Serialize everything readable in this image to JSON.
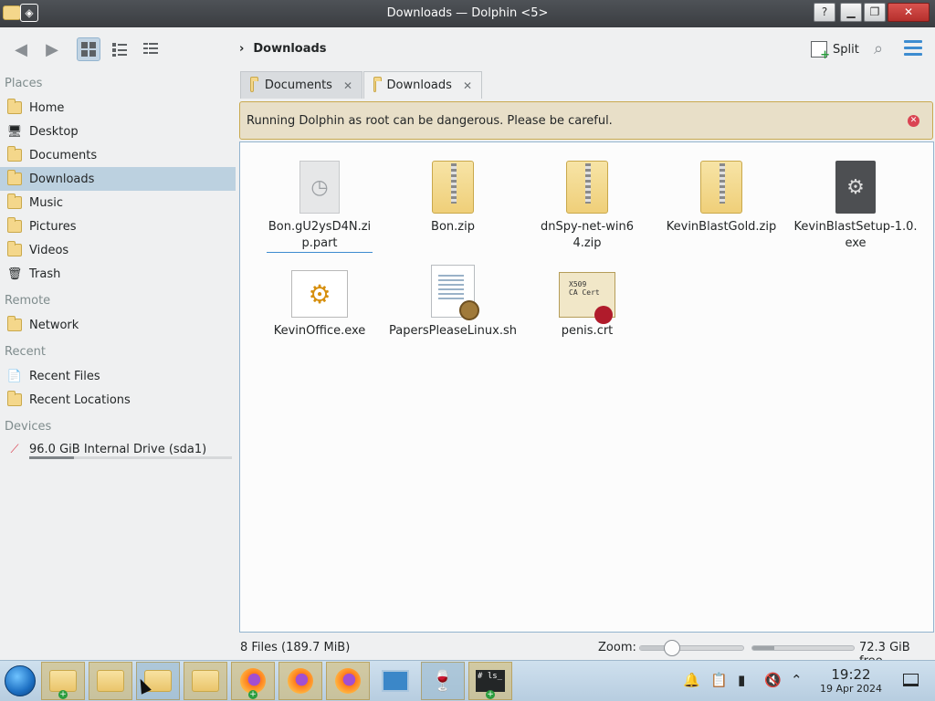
{
  "window": {
    "title": "Downloads — Dolphin <5>",
    "help": "?",
    "menu_glyph": "◈"
  },
  "toolbar": {
    "breadcrumb": "Downloads",
    "split_label": "Split"
  },
  "sidebar": {
    "sections": [
      {
        "label": "Places"
      },
      {
        "label": "Remote"
      },
      {
        "label": "Recent"
      },
      {
        "label": "Devices"
      }
    ],
    "places": [
      {
        "label": "Home",
        "icon": "home-icon"
      },
      {
        "label": "Desktop",
        "icon": "desktop-icon"
      },
      {
        "label": "Documents",
        "icon": "documents-icon"
      },
      {
        "label": "Downloads",
        "icon": "downloads-icon",
        "selected": true
      },
      {
        "label": "Music",
        "icon": "music-icon"
      },
      {
        "label": "Pictures",
        "icon": "pictures-icon"
      },
      {
        "label": "Videos",
        "icon": "videos-icon"
      },
      {
        "label": "Trash",
        "icon": "trash-icon"
      }
    ],
    "remote": [
      {
        "label": "Network",
        "icon": "network-icon"
      }
    ],
    "recent": [
      {
        "label": "Recent Files",
        "icon": "recent-files-icon"
      },
      {
        "label": "Recent Locations",
        "icon": "recent-locations-icon"
      }
    ],
    "devices": [
      {
        "label": "96.0 GiB Internal Drive (sda1)",
        "icon": "drive-icon",
        "usage_fraction": 0.22
      }
    ]
  },
  "tabs": [
    {
      "label": "Documents",
      "close": "✕"
    },
    {
      "label": "Downloads",
      "close": "✕"
    }
  ],
  "warning": {
    "text": "Running Dolphin as root can be dangerous. Please be careful."
  },
  "files": [
    {
      "name": "Bon.gU2ysD4N.zip.part",
      "icon": "partial-download-icon"
    },
    {
      "name": "Bon.zip",
      "icon": "zip-archive-icon"
    },
    {
      "name": "dnSpy-net-win64.zip",
      "icon": "zip-archive-icon"
    },
    {
      "name": "KevinBlastGold.zip",
      "icon": "zip-archive-icon"
    },
    {
      "name": "KevinBlastSetup-1.0.exe",
      "icon": "executable-icon"
    },
    {
      "name": "KevinOffice.exe",
      "icon": "wine-executable-icon"
    },
    {
      "name": "PapersPleaseLinux.sh",
      "icon": "shell-script-icon"
    },
    {
      "name": "penis.crt",
      "icon": "certificate-icon"
    }
  ],
  "cert_icon_text": "X509\nCA Cert",
  "status": {
    "summary": "8 Files (189.7 MiB)",
    "zoom_label": "Zoom:",
    "zoom_fraction": 0.3,
    "free_text": "72.3 GiB free",
    "used_fraction": 0.22
  },
  "taskbar": {
    "time": "19:22",
    "date": "19 Apr 2024",
    "terminal_text": "# ls_"
  },
  "colors": {
    "selection": "#bcd1e0",
    "warning_bg": "#e8dfc8",
    "warning_border": "#c9a94f",
    "accent": "#3d8cd0",
    "close_red": "#da4453"
  }
}
